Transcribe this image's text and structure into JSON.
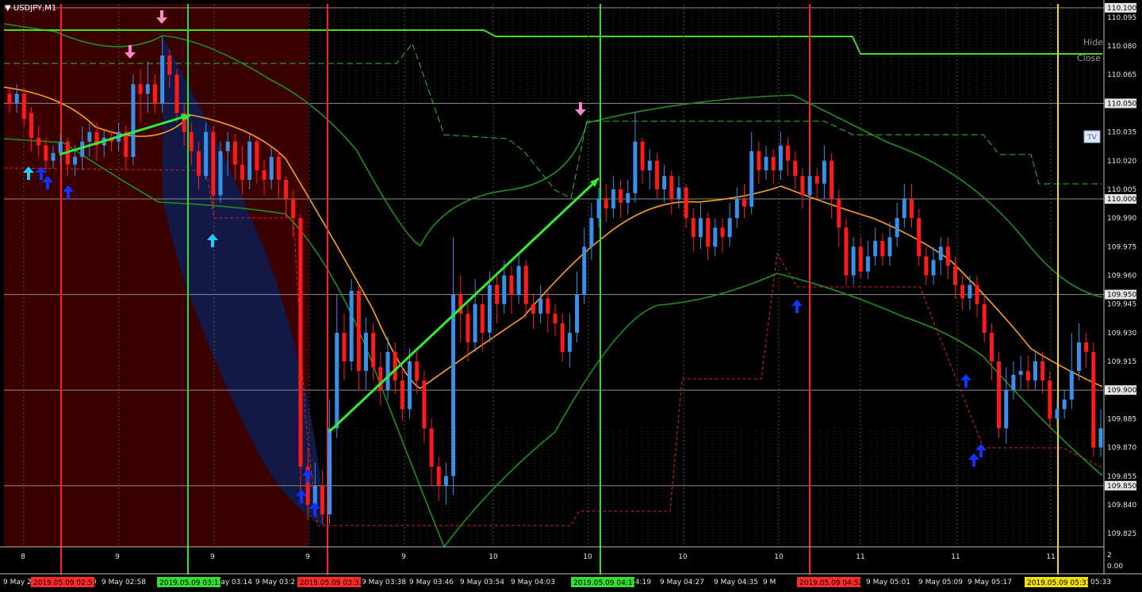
{
  "window": {
    "title": "USDJPY,M1",
    "menu_icon": "triangle-down-icon"
  },
  "controls": {
    "hide_label": "Hide",
    "close_label": "Close",
    "tv_label": "TV"
  },
  "price_axis": {
    "labels": [
      "110.095",
      "110.080",
      "110.065",
      "110.035",
      "110.020",
      "110.005",
      "109.990",
      "109.975",
      "109.960",
      "109.945",
      "109.930",
      "109.915",
      "109.885",
      "109.870",
      "109.855",
      "109.840",
      "109.825"
    ],
    "highlighted": [
      "110.100",
      "110.050",
      "110.000",
      "109.950",
      "109.900",
      "109.850"
    ],
    "bottom_a": "2",
    "bottom_b": "0.00"
  },
  "subwindow": {
    "labels": [
      "8",
      "9",
      "9",
      "9",
      "9",
      "10",
      "10",
      "10",
      "10",
      "11",
      "11",
      "11"
    ]
  },
  "time_axis": {
    "labels": [
      "9 May 2",
      "0",
      "9 May 02:58",
      "9 May 03:14",
      "9 May 03:2",
      "9 May 03:38",
      "9 May 03:46",
      "9 May 03:54",
      "9 May 04:03",
      "04:19",
      "9 May 04:27",
      "9 May 04:35",
      "9 M",
      "4:53",
      "9 May 05:01",
      "9 May 05:09",
      "9 May 05:17",
      "05:33"
    ]
  },
  "time_tags": [
    {
      "label": "2019.05.09 02:51",
      "color": "#ff2a2a"
    },
    {
      "label": "2019.05.09 03:11",
      "color": "#33dd33"
    },
    {
      "label": "2019.05.09 03:33",
      "color": "#ff2a2a"
    },
    {
      "label": "2019.05.09 04:17",
      "color": "#33dd33"
    },
    {
      "label": "2019.05.09 04:52",
      "color": "#ff2a2a"
    },
    {
      "label": "2019.05.09 05:31",
      "color": "#f0e000"
    }
  ],
  "colors": {
    "bull": "#3a8fe8",
    "bear": "#ff1a1a",
    "ma": "#ffa020",
    "band": "#1f8f1f",
    "grid": "#6a6a6a",
    "red_zone": "#3a0000",
    "blue_zone": "#101a4a"
  },
  "chart_data": {
    "type": "candlestick",
    "symbol": "USDJPY",
    "timeframe": "M1",
    "ylim": [
      109.818,
      110.102
    ],
    "highlight_levels": [
      110.1,
      110.05,
      110.0,
      109.95,
      109.9,
      109.85
    ],
    "upper_band_level": 110.096,
    "candles": [
      [
        110.055,
        110.05,
        110.058,
        110.045
      ],
      [
        110.05,
        110.055,
        110.06,
        110.045
      ],
      [
        110.055,
        110.042,
        110.058,
        110.038
      ],
      [
        110.045,
        110.032,
        110.048,
        110.025
      ],
      [
        110.032,
        110.028,
        110.038,
        110.022
      ],
      [
        110.028,
        110.02,
        110.032,
        110.015
      ],
      [
        110.02,
        110.024,
        110.028,
        110.016
      ],
      [
        110.024,
        110.03,
        110.034,
        110.018
      ],
      [
        110.03,
        110.018,
        110.032,
        110.012
      ],
      [
        110.018,
        110.022,
        110.028,
        110.012
      ],
      [
        110.022,
        110.03,
        110.038,
        110.015
      ],
      [
        110.03,
        110.035,
        110.04,
        110.022
      ],
      [
        110.035,
        110.028,
        110.04,
        110.02
      ],
      [
        110.028,
        110.032,
        110.036,
        110.022
      ],
      [
        110.032,
        110.03,
        110.036,
        110.025
      ],
      [
        110.03,
        110.035,
        110.04,
        110.025
      ],
      [
        110.035,
        110.022,
        110.038,
        110.015
      ],
      [
        110.022,
        110.06,
        110.065,
        110.018
      ],
      [
        110.06,
        110.055,
        110.068,
        110.04
      ],
      [
        110.055,
        110.06,
        110.072,
        110.045
      ],
      [
        110.06,
        110.05,
        110.065,
        110.045
      ],
      [
        110.05,
        110.075,
        110.085,
        110.045
      ],
      [
        110.075,
        110.065,
        110.078,
        110.058
      ],
      [
        110.065,
        110.045,
        110.068,
        110.04
      ],
      [
        110.045,
        110.035,
        110.05,
        110.028
      ],
      [
        110.035,
        110.025,
        110.04,
        110.018
      ],
      [
        110.025,
        110.012,
        110.03,
        110.005
      ],
      [
        110.012,
        110.035,
        110.04,
        110.01
      ],
      [
        110.035,
        110.002,
        110.038,
        109.995
      ],
      [
        110.002,
        110.025,
        110.03,
        109.998
      ],
      [
        110.025,
        110.03,
        110.035,
        110.012
      ],
      [
        110.03,
        110.018,
        110.034,
        110.01
      ],
      [
        110.018,
        110.01,
        110.028,
        110.002
      ],
      [
        110.01,
        110.03,
        110.034,
        110.005
      ],
      [
        110.03,
        110.015,
        110.032,
        110.008
      ],
      [
        110.015,
        110.01,
        110.02,
        110.002
      ],
      [
        110.01,
        110.022,
        110.028,
        110.005
      ],
      [
        110.022,
        110.01,
        110.025,
        110.0
      ],
      [
        110.01,
        110.0,
        110.012,
        109.99
      ],
      [
        110.0,
        109.99,
        110.005,
        109.98
      ],
      [
        109.99,
        109.86,
        109.992,
        109.845
      ],
      [
        109.86,
        109.84,
        109.87,
        109.832
      ],
      [
        109.84,
        109.85,
        109.862,
        109.835
      ],
      [
        109.85,
        109.835,
        109.858,
        109.83
      ],
      [
        109.835,
        109.88,
        109.895,
        109.83
      ],
      [
        109.88,
        109.93,
        109.95,
        109.875
      ],
      [
        109.93,
        109.915,
        109.94,
        109.905
      ],
      [
        109.915,
        109.952,
        109.958,
        109.91
      ],
      [
        109.952,
        109.91,
        109.955,
        109.9
      ],
      [
        109.91,
        109.93,
        109.938,
        109.9
      ],
      [
        109.93,
        109.912,
        109.935,
        109.905
      ],
      [
        109.912,
        109.9,
        109.92,
        109.892
      ],
      [
        109.9,
        109.92,
        109.928,
        109.895
      ],
      [
        109.92,
        109.905,
        109.925,
        109.898
      ],
      [
        109.905,
        109.89,
        109.912,
        109.884
      ],
      [
        109.89,
        109.915,
        109.922,
        109.885
      ],
      [
        109.915,
        109.905,
        109.92,
        109.898
      ],
      [
        109.905,
        109.88,
        109.91,
        109.872
      ],
      [
        109.88,
        109.86,
        109.885,
        109.85
      ],
      [
        109.86,
        109.85,
        109.865,
        109.842
      ],
      [
        109.85,
        109.855,
        109.862,
        109.84
      ],
      [
        109.855,
        109.95,
        109.98,
        109.845
      ],
      [
        109.95,
        109.94,
        109.96,
        109.925
      ],
      [
        109.94,
        109.925,
        109.945,
        109.915
      ],
      [
        109.925,
        109.945,
        109.958,
        109.92
      ],
      [
        109.945,
        109.93,
        109.95,
        109.92
      ],
      [
        109.93,
        109.955,
        109.962,
        109.925
      ],
      [
        109.955,
        109.945,
        109.962,
        109.935
      ],
      [
        109.945,
        109.96,
        109.968,
        109.94
      ],
      [
        109.96,
        109.95,
        109.965,
        109.94
      ],
      [
        109.95,
        109.965,
        109.972,
        109.945
      ],
      [
        109.965,
        109.945,
        109.968,
        109.938
      ],
      [
        109.945,
        109.94,
        109.95,
        109.932
      ],
      [
        109.94,
        109.948,
        109.955,
        109.935
      ],
      [
        109.948,
        109.94,
        109.952,
        109.93
      ],
      [
        109.94,
        109.935,
        109.945,
        109.928
      ],
      [
        109.935,
        109.92,
        109.94,
        109.915
      ],
      [
        109.92,
        109.93,
        109.94,
        109.912
      ],
      [
        109.93,
        109.95,
        109.962,
        109.925
      ],
      [
        109.95,
        109.975,
        109.985,
        109.945
      ],
      [
        109.975,
        109.99,
        109.998,
        109.968
      ],
      [
        109.99,
        110.0,
        110.006,
        109.985
      ],
      [
        110.0,
        109.995,
        110.008,
        109.988
      ],
      [
        109.995,
        110.005,
        110.012,
        109.99
      ],
      [
        110.005,
        109.998,
        110.01,
        109.99
      ],
      [
        109.998,
        110.003,
        110.01,
        109.992
      ],
      [
        110.003,
        110.03,
        110.045,
        109.998
      ],
      [
        110.03,
        110.015,
        110.032,
        110.008
      ],
      [
        110.015,
        110.02,
        110.026,
        110.005
      ],
      [
        110.02,
        110.005,
        110.024,
        110.0
      ],
      [
        110.005,
        110.012,
        110.018,
        109.998
      ],
      [
        110.012,
        110.0,
        110.015,
        109.992
      ],
      [
        110.0,
        110.006,
        110.012,
        109.995
      ],
      [
        110.006,
        109.99,
        110.008,
        109.985
      ],
      [
        109.99,
        109.98,
        109.995,
        109.972
      ],
      [
        109.98,
        109.99,
        109.998,
        109.974
      ],
      [
        109.99,
        109.975,
        109.993,
        109.968
      ],
      [
        109.975,
        109.985,
        109.99,
        109.97
      ],
      [
        109.985,
        109.98,
        109.99,
        109.972
      ],
      [
        109.98,
        109.99,
        109.998,
        109.975
      ],
      [
        109.99,
        110.0,
        110.006,
        109.985
      ],
      [
        110.0,
        109.996,
        110.008,
        109.99
      ],
      [
        109.996,
        110.025,
        110.035,
        109.992
      ],
      [
        110.025,
        110.015,
        110.03,
        110.008
      ],
      [
        110.015,
        110.022,
        110.028,
        110.01
      ],
      [
        110.022,
        110.015,
        110.026,
        110.008
      ],
      [
        110.015,
        110.028,
        110.035,
        110.01
      ],
      [
        110.028,
        110.02,
        110.032,
        110.012
      ],
      [
        110.02,
        110.012,
        110.025,
        110.005
      ],
      [
        110.012,
        110.002,
        110.016,
        109.995
      ],
      [
        110.002,
        110.012,
        110.018,
        109.998
      ],
      [
        110.012,
        110.008,
        110.016,
        110.0
      ],
      [
        110.008,
        110.02,
        110.028,
        110.0
      ],
      [
        110.02,
        110.0,
        110.024,
        109.99
      ],
      [
        110.0,
        109.985,
        110.005,
        109.975
      ],
      [
        109.985,
        109.96,
        109.99,
        109.955
      ],
      [
        109.96,
        109.975,
        109.98,
        109.955
      ],
      [
        109.975,
        109.962,
        109.98,
        109.958
      ],
      [
        109.962,
        109.97,
        109.978,
        109.958
      ],
      [
        109.97,
        109.978,
        109.985,
        109.965
      ],
      [
        109.978,
        109.97,
        109.982,
        109.965
      ],
      [
        109.97,
        109.98,
        109.988,
        109.965
      ],
      [
        109.98,
        109.99,
        109.998,
        109.975
      ],
      [
        109.99,
        110.0,
        110.008,
        109.985
      ],
      [
        110.0,
        109.99,
        110.008,
        109.985
      ],
      [
        109.99,
        109.97,
        109.995,
        109.965
      ],
      [
        109.97,
        109.96,
        109.975,
        109.955
      ],
      [
        109.96,
        109.968,
        109.975,
        109.955
      ],
      [
        109.968,
        109.975,
        109.98,
        109.96
      ],
      [
        109.975,
        109.965,
        109.98,
        109.958
      ],
      [
        109.965,
        109.955,
        109.97,
        109.948
      ],
      [
        109.955,
        109.948,
        109.96,
        109.942
      ],
      [
        109.948,
        109.955,
        109.96,
        109.942
      ],
      [
        109.955,
        109.945,
        109.96,
        109.938
      ],
      [
        109.945,
        109.93,
        109.95,
        109.925
      ],
      [
        109.93,
        109.915,
        109.935,
        109.905
      ],
      [
        109.915,
        109.88,
        109.92,
        109.875
      ],
      [
        109.88,
        109.9,
        109.912,
        109.872
      ],
      [
        109.9,
        109.908,
        109.915,
        109.895
      ],
      [
        109.908,
        109.91,
        109.918,
        109.9
      ],
      [
        109.91,
        109.905,
        109.918,
        109.9
      ],
      [
        109.905,
        109.915,
        109.92,
        109.9
      ],
      [
        109.915,
        109.905,
        109.92,
        109.898
      ],
      [
        109.905,
        109.885,
        109.91,
        109.88
      ],
      [
        109.885,
        109.89,
        109.895,
        109.88
      ],
      [
        109.89,
        109.895,
        109.9,
        109.885
      ],
      [
        109.895,
        109.91,
        109.93,
        109.89
      ],
      [
        109.91,
        109.925,
        109.935,
        109.905
      ],
      [
        109.925,
        109.92,
        109.93,
        109.912
      ],
      [
        109.92,
        109.87,
        109.925,
        109.865
      ],
      [
        109.87,
        109.88,
        109.89,
        109.865
      ]
    ]
  }
}
